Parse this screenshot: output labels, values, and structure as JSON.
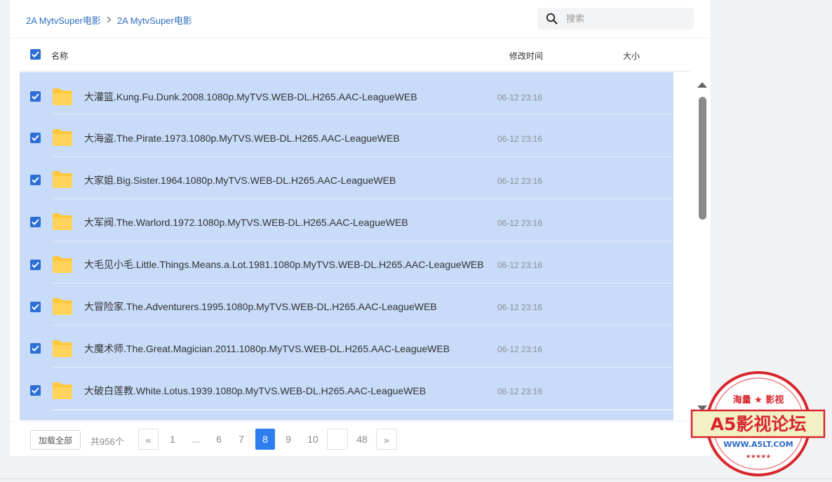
{
  "breadcrumb": [
    "2A MytvSuper电影",
    "2A MytvSuper电影"
  ],
  "search": {
    "placeholder": "搜索"
  },
  "columns": {
    "name": "名称",
    "mtime": "修改时间",
    "size": "大小"
  },
  "files": [
    {
      "name": "大灌篮.Kung.Fu.Dunk.2008.1080p.MyTVS.WEB-DL.H265.AAC-LeagueWEB",
      "time": "06-12 23:16",
      "selected": true
    },
    {
      "name": "大海盗.The.Pirate.1973.1080p.MyTVS.WEB-DL.H265.AAC-LeagueWEB",
      "time": "06-12 23:16",
      "selected": true
    },
    {
      "name": "大家姐.Big.Sister.1964.1080p.MyTVS.WEB-DL.H265.AAC-LeagueWEB",
      "time": "06-12 23:16",
      "selected": true
    },
    {
      "name": "大军阀.The.Warlord.1972.1080p.MyTVS.WEB-DL.H265.AAC-LeagueWEB",
      "time": "06-12 23:16",
      "selected": true
    },
    {
      "name": "大毛见小毛.Little.Things.Means.a.Lot.1981.1080p.MyTVS.WEB-DL.H265.AAC-LeagueWEB",
      "time": "06-12 23:16",
      "selected": true
    },
    {
      "name": "大冒险家.The.Adventurers.1995.1080p.MyTVS.WEB-DL.H265.AAC-LeagueWEB",
      "time": "06-12 23:16",
      "selected": true
    },
    {
      "name": "大魔术师.The.Great.Magician.2011.1080p.MyTVS.WEB-DL.H265.AAC-LeagueWEB",
      "time": "06-12 23:16",
      "selected": true
    },
    {
      "name": "大破白莲教.White.Lotus.1939.1080p.MyTVS.WEB-DL.H265.AAC-LeagueWEB",
      "time": "06-12 23:16",
      "selected": true
    }
  ],
  "footer": {
    "load_all": "加载全部",
    "total": "共956个",
    "prev": "«",
    "next": "»",
    "pages": [
      "1",
      "...",
      "6",
      "7",
      "8",
      "9",
      "10",
      "",
      "48"
    ],
    "current": "8"
  },
  "watermark": {
    "top": "海量 ★ 影视",
    "main": "A5影视论坛",
    "url": "WWW.A5LT.COM"
  },
  "colors": {
    "accent": "#2f7ef0",
    "selection": "#c8dbf8",
    "folder": "#ffc83d",
    "stamp": "#d8262c"
  }
}
